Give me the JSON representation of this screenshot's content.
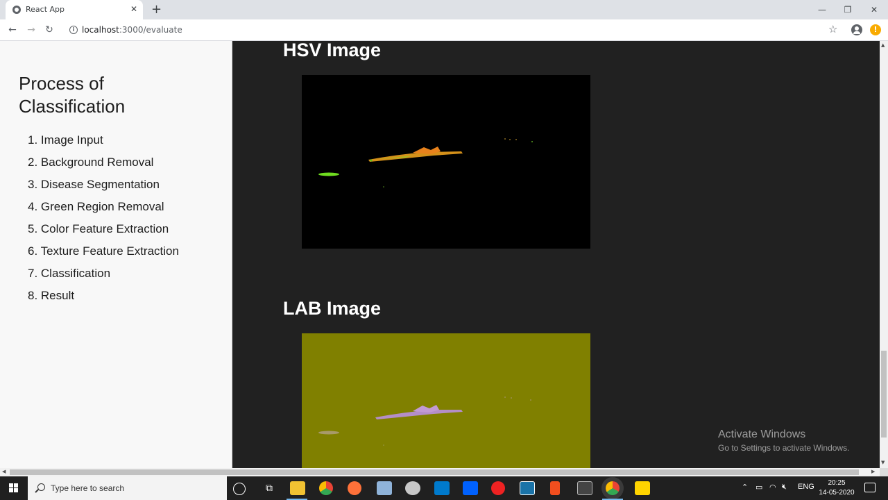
{
  "browser": {
    "tab_title": "React App",
    "close_glyph": "✕",
    "newtab_glyph": "+",
    "url_host": "localhost",
    "url_rest": ":3000/evaluate",
    "window_controls": {
      "minimize": "—",
      "restore": "❐",
      "close": "✕"
    },
    "nav": {
      "back": "←",
      "forward": "→",
      "reload": "↻"
    },
    "bookmark_glyph": "☆",
    "update_glyph": "!"
  },
  "sidebar": {
    "title": "Process of Classification",
    "steps": [
      "1. Image Input",
      "2. Background Removal",
      "3. Disease Segmentation",
      "4. Green Region Removal",
      "5. Color Feature Extraction",
      "6. Texture Feature Extraction",
      "7. Classification",
      "8. Result"
    ]
  },
  "main": {
    "sections": [
      {
        "heading": "HSV Image"
      },
      {
        "heading": "LAB Image"
      }
    ],
    "watermark": {
      "line1": "Activate Windows",
      "line2": "Go to Settings to activate Windows."
    }
  },
  "taskbar": {
    "search_placeholder": "Type here to search",
    "tray_lang": "ENG",
    "time": "20:25",
    "date": "14-05-2020",
    "apps": [
      "file-explorer",
      "chrome",
      "firefox",
      "notepad-plus",
      "paint",
      "vscode",
      "dropbox",
      "screen-recorder",
      "v-app",
      "figma",
      "terminal",
      "chrome-active",
      "sticky-notes"
    ]
  },
  "colors": {
    "sidebar_bg": "#f8f8f8",
    "main_bg": "#212121",
    "hsv_bg": "#000000",
    "lab_bg": "#808000"
  }
}
